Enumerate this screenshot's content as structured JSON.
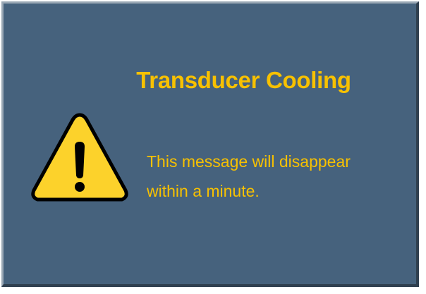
{
  "dialog": {
    "title": "Transducer Cooling",
    "message_line1": "This message will disappear",
    "message_line2": "within a minute.",
    "icon": "warning-icon"
  },
  "colors": {
    "background": "#46627d",
    "text": "#f8c100",
    "icon_fill": "#fcd22b",
    "icon_outline": "#000000"
  }
}
